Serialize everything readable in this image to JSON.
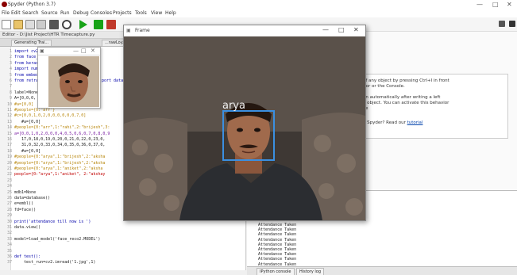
{
  "app": {
    "title": "Spyder (Python 3.7)",
    "menu": [
      "File",
      "Edit",
      "Search",
      "Source",
      "Run",
      "Debug",
      "Consoles",
      "Projects",
      "Tools",
      "View",
      "Help"
    ],
    "window_controls": [
      "—",
      "□",
      "✕"
    ]
  },
  "editor": {
    "path": "Editor - D:\\Jist Project\\HTR Timecapture.py",
    "tabs": [
      "Generating Trai...",
      "...rawLoy.py"
    ],
    "lines": [
      {
        "n": "1",
        "t": "import cv2"
      },
      {
        "n": "2",
        "t": "from face_"
      },
      {
        "n": "3",
        "t": "from keras"
      },
      {
        "n": "4",
        "t": "import num"
      },
      {
        "n": "5",
        "t": "from embed"
      },
      {
        "n": "6",
        "t": "from retra"
      },
      {
        "n": "7",
        "t": ""
      },
      {
        "n": "8",
        "t": "label=None"
      },
      {
        "n": "9",
        "t": "A=[0,0,0,"
      },
      {
        "n": "10",
        "t": "#a=[0,0]"
      },
      {
        "n": "11",
        "t": "#people={0:\"arr\"}"
      },
      {
        "n": "12",
        "t": "#c=[0,0,1,0,2,0,0,0,0,0,0,7,0]"
      },
      {
        "n": "13",
        "t": "   #a=[0,0]"
      },
      {
        "n": "14",
        "t": "#people={0:\"arr\",1:\"rahi\",2:\"brijesh\",3:"
      },
      {
        "n": "15",
        "t": "a=[0,0,1,0,2,0,0,0,4,0,5,0,6,0,7,0,8,0,9"
      },
      {
        "n": "16",
        "t": "   17,0,18,0,19,0,20,0,21,0,22,0,23,0,"
      },
      {
        "n": "17",
        "t": "   31,0,32,0,33,0,34,0,35,0,36,0,37,0,"
      },
      {
        "n": "18",
        "t": "   #a=[0,0]"
      },
      {
        "n": "19",
        "t": "#people={0:\"arya\",1:\"brijesh\",2:\"aksha"
      },
      {
        "n": "20",
        "t": "#people={0:\"arya\",1:\"brijesh\",2:\"aksha"
      },
      {
        "n": "21",
        "t": "#people={0:\"arya\",1:\"aniket\",2:\"aksha"
      },
      {
        "n": "22",
        "t": "people={0:\"arya\",1:\"aniket\", 2:\"akshay"
      },
      {
        "n": "23",
        "t": ""
      },
      {
        "n": "24",
        "t": ""
      },
      {
        "n": "25",
        "t": "mdb1=None"
      },
      {
        "n": "26",
        "t": "data=database()"
      },
      {
        "n": "27",
        "t": "e=embl()"
      },
      {
        "n": "28",
        "t": "fd=face()"
      },
      {
        "n": "29",
        "t": ""
      },
      {
        "n": "30",
        "t": "print('attendance till now is ')"
      },
      {
        "n": "31",
        "t": "data.view()"
      },
      {
        "n": "32",
        "t": ""
      },
      {
        "n": "33",
        "t": "model=load_model('face_reco2.MODEL')"
      },
      {
        "n": "34",
        "t": ""
      },
      {
        "n": "35",
        "t": ""
      },
      {
        "n": "36",
        "t": "def test():"
      },
      {
        "n": "37",
        "t": "    test_run=cv2.imread('1.jpg',1)"
      }
    ],
    "line6_tail": "port data"
  },
  "help": {
    "lines": [
      "of any object by pressing Ctrl+I in front",
      "itor or the Console.",
      "",
      "en automatically after writing a left",
      "e object. You can activate this behavior",
      "ce"
    ],
    "prompt": "o Spyder? Read our",
    "link": "tutorial"
  },
  "console": {
    "lines": [
      "Attendance Taken",
      "Attendance Taken",
      "Attendance Taken",
      "Attendance Taken",
      "Attendance Taken",
      "Attendance Taken",
      "Attendance Taken",
      "Attendance Taken",
      "Attendance Taken"
    ],
    "tabs": [
      "IPython console",
      "History log"
    ]
  },
  "frame_window": {
    "title": "Frame",
    "detected_name": "arya",
    "controls": [
      "—",
      "□",
      "✕"
    ]
  },
  "small_window": {
    "controls": [
      "—",
      "□",
      "✕"
    ]
  },
  "colors": {
    "face_box": "#3b8fe0"
  }
}
